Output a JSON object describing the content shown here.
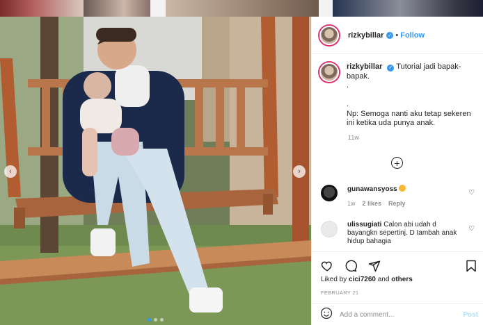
{
  "post": {
    "username": "rizkybillar",
    "follow_label": "Follow",
    "separator": "•",
    "caption": "Tutorial jadi bapak-bapak.",
    "caption_dot1": ".",
    "caption_dot2": ".",
    "caption_np": "Np: Semoga nanti aku tetap sekeren ini ketika uda punya anak.",
    "caption_time": "11w",
    "likes_prefix": "Liked by",
    "liked_by_user": "cici7260",
    "likes_conj": "and",
    "likes_others": "others",
    "date": "FEBRUARY 21"
  },
  "comments": [
    {
      "user": "gunawansyoss",
      "text": "",
      "emoji": "star-struck",
      "time": "1w",
      "likes": "2 likes",
      "reply": "Reply"
    },
    {
      "user": "ulissugiati",
      "text": "Calon abi udah d bayangkn sepertinj. D tambah anak hidup bahagia",
      "time": "",
      "likes": "",
      "reply": ""
    }
  ],
  "add_comment": {
    "placeholder": "Add a comment...",
    "post_label": "Post"
  },
  "colors": {
    "accent": "#3897f0",
    "story_ring": "#e1306c",
    "post_disabled": "#b2dffc"
  },
  "icons": [
    "heart-icon",
    "comment-icon",
    "share-icon",
    "bookmark-icon",
    "plus-circle-icon",
    "smiley-icon",
    "verified-icon",
    "chevron-left-icon",
    "chevron-right-icon"
  ],
  "carousel": {
    "slides": 3,
    "active_index": 0
  }
}
